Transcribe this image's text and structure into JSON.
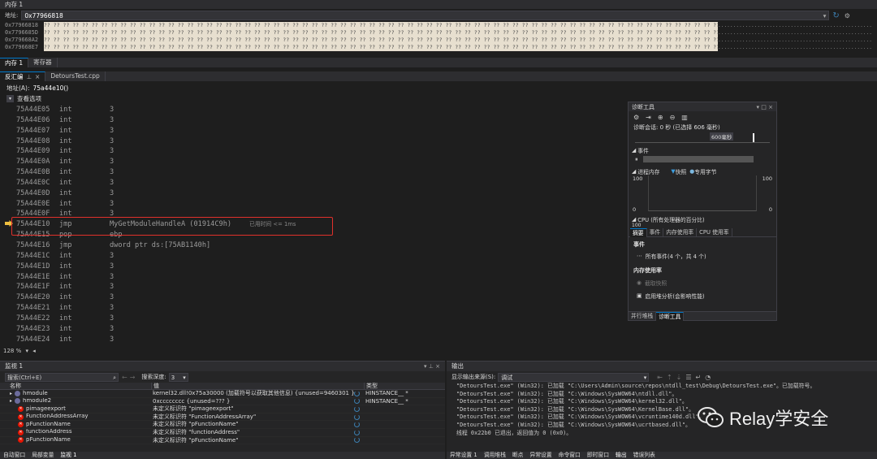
{
  "memory": {
    "title": "内存 1",
    "addr_label": "地址:",
    "addr_value": "0x77966818",
    "rows": [
      {
        "addr": "0x77966818",
        "bytes": "?? ?? ?? ?? ?? ?? ?? ?? ?? ?? ?? ?? ?? ?? ?? ?? ?? ?? ?? ?? ?? ?? ?? ?? ?? ?? ?? ?? ?? ?? ?? ?? ?? ?? ?? ?? ?? ?? ?? ?? ?? ?? ?? ?? ?? ?? ?? ?? ?? ?? ?? ?? ?? ?? ?? ?? ?? ?? ?? ?? ?? ?? ?? ?? ?? ?? ?? ?? ?? ?? ??",
        "ascii": "....................................................................."
      },
      {
        "addr": "0x7796685D",
        "bytes": "?? ?? ?? ?? ?? ?? ?? ?? ?? ?? ?? ?? ?? ?? ?? ?? ?? ?? ?? ?? ?? ?? ?? ?? ?? ?? ?? ?? ?? ?? ?? ?? ?? ?? ?? ?? ?? ?? ?? ?? ?? ?? ?? ?? ?? ?? ?? ?? ?? ?? ?? ?? ?? ?? ?? ?? ?? ?? ?? ?? ?? ?? ?? ?? ?? ?? ?? ?? ?? ?? ??",
        "ascii": "....................................................................."
      },
      {
        "addr": "0x779668A2",
        "bytes": "?? ?? ?? ?? ?? ?? ?? ?? ?? ?? ?? ?? ?? ?? ?? ?? ?? ?? ?? ?? ?? ?? ?? ?? ?? ?? ?? ?? ?? ?? ?? ?? ?? ?? ?? ?? ?? ?? ?? ?? ?? ?? ?? ?? ?? ?? ?? ?? ?? ?? ?? ?? ?? ?? ?? ?? ?? ?? ?? ?? ?? ?? ?? ?? ?? ?? ?? ?? ?? ?? ??",
        "ascii": "....................................................................."
      },
      {
        "addr": "0x779668E7",
        "bytes": "?? ?? ?? ?? ?? ?? ?? ?? ?? ?? ?? ?? ?? ?? ?? ?? ?? ?? ?? ?? ?? ?? ?? ?? ?? ?? ?? ?? ?? ?? ?? ?? ?? ?? ?? ?? ?? ?? ?? ?? ?? ?? ?? ?? ?? ?? ?? ?? ?? ?? ?? ?? ?? ?? ?? ?? ?? ?? ?? ?? ?? ?? ?? ?? ?? ?? ?? ?? ?? ?? ??",
        "ascii": "....................................................................."
      }
    ],
    "bottom_tabs": [
      "内存 1",
      "寄存器"
    ]
  },
  "doc_tabs": [
    "反汇编",
    "DetoursTest.cpp"
  ],
  "disasm": {
    "addr_label": "地址(A):",
    "addr_value": "75a44e10()",
    "view_options": "查看选项",
    "elapsed": "已用时间 <= 1ms",
    "rows": [
      {
        "addr": "75A44E05",
        "op": "int",
        "arg": "3"
      },
      {
        "addr": "75A44E06",
        "op": "int",
        "arg": "3"
      },
      {
        "addr": "75A44E07",
        "op": "int",
        "arg": "3"
      },
      {
        "addr": "75A44E08",
        "op": "int",
        "arg": "3"
      },
      {
        "addr": "75A44E09",
        "op": "int",
        "arg": "3"
      },
      {
        "addr": "75A44E0A",
        "op": "int",
        "arg": "3"
      },
      {
        "addr": "75A44E0B",
        "op": "int",
        "arg": "3"
      },
      {
        "addr": "75A44E0C",
        "op": "int",
        "arg": "3"
      },
      {
        "addr": "75A44E0D",
        "op": "int",
        "arg": "3"
      },
      {
        "addr": "75A44E0E",
        "op": "int",
        "arg": "3"
      },
      {
        "addr": "75A44E0F",
        "op": "int",
        "arg": "3"
      },
      {
        "addr": "75A44E10",
        "op": "jmp",
        "arg": "MyGetModuleHandleA (01914C9h)",
        "current": true
      },
      {
        "addr": "75A44E15",
        "op": "pop",
        "arg": "ebp"
      },
      {
        "addr": "75A44E16",
        "op": "jmp",
        "arg": "dword ptr ds:[75AB1140h]"
      },
      {
        "addr": "75A44E1C",
        "op": "int",
        "arg": "3"
      },
      {
        "addr": "75A44E1D",
        "op": "int",
        "arg": "3"
      },
      {
        "addr": "75A44E1E",
        "op": "int",
        "arg": "3"
      },
      {
        "addr": "75A44E1F",
        "op": "int",
        "arg": "3"
      },
      {
        "addr": "75A44E20",
        "op": "int",
        "arg": "3"
      },
      {
        "addr": "75A44E21",
        "op": "int",
        "arg": "3"
      },
      {
        "addr": "75A44E22",
        "op": "int",
        "arg": "3"
      },
      {
        "addr": "75A44E23",
        "op": "int",
        "arg": "3"
      },
      {
        "addr": "75A44E24",
        "op": "int",
        "arg": "3"
      }
    ],
    "zoom": "128 %"
  },
  "diag": {
    "title": "诊断工具",
    "session": "诊断会话: 0 秒 (已选择 606 毫秒)",
    "timeline_label": "600毫秒",
    "events": "事件",
    "process_memory": "进程内存",
    "snapshot": "快照",
    "private_bytes": "专用字节",
    "mem_top": "100",
    "mem_bottom": "0",
    "cpu": "CPU (所有处理器的百分比)",
    "cpu_top": "100",
    "tabs": [
      "摘要",
      "事件",
      "内存使用率",
      "CPU 使用率"
    ],
    "sec_events": "事件",
    "all_events": "所有事件(4 个，共 4 个)",
    "sec_memory": "内存使用率",
    "take_snapshot": "截取快照",
    "heap_analysis": "启用堆分析(会影响性能)",
    "bottom_tabs": [
      "并行堆栈",
      "诊断工具"
    ]
  },
  "watch": {
    "title": "监视 1",
    "search_placeholder": "搜索(Ctrl+E)",
    "depth_label": "搜索深度:",
    "depth_value": "3",
    "cols": [
      "名称",
      "值",
      "类型"
    ],
    "rows": [
      {
        "name": "hmodule",
        "value": "kernel32.dll!0x75a30000 (加载符号以获取其他信息) {unused=9460301 }",
        "type": "HINSTANCE__ *",
        "kind": "obj"
      },
      {
        "name": "hmodule2",
        "value": "0xcccccccc {unused=??? }",
        "type": "HINSTANCE__ *",
        "kind": "obj"
      },
      {
        "name": "pimageexport",
        "value": "未定义标识符 \"pimageexport\"",
        "type": "",
        "kind": "err"
      },
      {
        "name": "FunctionAddressArray",
        "value": "未定义标识符 \"FunctionAddressArray\"",
        "type": "",
        "kind": "err"
      },
      {
        "name": "pFunctionName",
        "value": "未定义标识符 \"pFunctionName\"",
        "type": "",
        "kind": "err"
      },
      {
        "name": "functionAddress",
        "value": "未定义标识符 \"functionAddress\"",
        "type": "",
        "kind": "err"
      },
      {
        "name": "pFunctionName",
        "value": "未定义标识符 \"pFunctionName\"",
        "type": "",
        "kind": "err"
      }
    ],
    "bottom_tabs": [
      "自动窗口",
      "局部变量",
      "监视 1"
    ]
  },
  "output": {
    "title": "输出",
    "source_label": "显示输出来源(S):",
    "source_value": "调试",
    "lines": [
      "\"DetoursTest.exe\" (Win32): 已加载 \"C:\\Users\\Admin\\source\\repos\\ntdll_test\\Debug\\DetoursTest.exe\"。已加载符号。",
      "\"DetoursTest.exe\" (Win32): 已加载 \"C:\\Windows\\SysWOW64\\ntdll.dll\"。",
      "\"DetoursTest.exe\" (Win32): 已加载 \"C:\\Windows\\SysWOW64\\kernel32.dll\"。",
      "\"DetoursTest.exe\" (Win32): 已加载 \"C:\\Windows\\SysWOW64\\KernelBase.dll\"。",
      "\"DetoursTest.exe\" (Win32): 已加载 \"C:\\Windows\\SysWOW64\\vcruntime140d.dll\"。",
      "\"DetoursTest.exe\" (Win32): 已加载 \"C:\\Windows\\SysWOW64\\ucrtbased.dll\"。",
      "线程 0x22b0 已退出，返回值为 0 (0x0)。"
    ],
    "bottom_tabs": [
      "异常设置 1",
      "调用堆栈",
      "断点",
      "异常设置",
      "命令窗口",
      "即时窗口",
      "输出",
      "错误列表"
    ]
  },
  "watermark": "Relay学安全",
  "colors": {
    "accent": "#007acc",
    "highlight_box": "#e0302b",
    "memory_bg": "#e7dfcf"
  }
}
